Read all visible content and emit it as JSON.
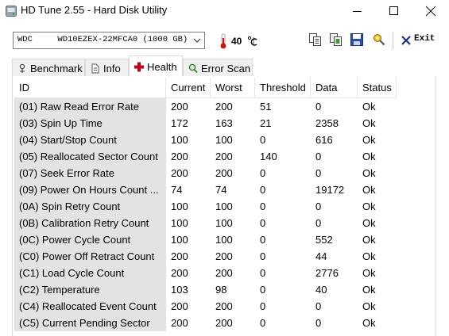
{
  "window": {
    "title": "HD Tune 2.55 - Hard Disk Utility"
  },
  "toolbar": {
    "drive": "WDC     WD10EZEX-22MFCA0 (1000 GB)",
    "temperature": "40",
    "exit_label": "Exit"
  },
  "tabs": [
    {
      "label": "Benchmark",
      "icon": "benchmark-icon"
    },
    {
      "label": "Info",
      "icon": "info-icon"
    },
    {
      "label": "Health",
      "icon": "health-cross-icon",
      "active": true
    },
    {
      "label": "Error Scan",
      "icon": "magnifier-icon"
    }
  ],
  "table": {
    "columns": [
      "ID",
      "Current",
      "Worst",
      "Threshold",
      "Data",
      "Status"
    ],
    "rows": [
      [
        "(01) Raw Read Error Rate",
        "200",
        "200",
        "51",
        "0",
        "Ok"
      ],
      [
        "(03) Spin Up Time",
        "172",
        "163",
        "21",
        "2358",
        "Ok"
      ],
      [
        "(04) Start/Stop Count",
        "100",
        "100",
        "0",
        "616",
        "Ok"
      ],
      [
        "(05) Reallocated Sector Count",
        "200",
        "200",
        "140",
        "0",
        "Ok"
      ],
      [
        "(07) Seek Error Rate",
        "200",
        "200",
        "0",
        "0",
        "Ok"
      ],
      [
        "(09) Power On Hours Count  ...",
        "74",
        "74",
        "0",
        "19172",
        "Ok"
      ],
      [
        "(0A) Spin Retry Count",
        "100",
        "100",
        "0",
        "0",
        "Ok"
      ],
      [
        "(0B) Calibration Retry Count",
        "100",
        "100",
        "0",
        "0",
        "Ok"
      ],
      [
        "(0C) Power Cycle Count",
        "100",
        "100",
        "0",
        "552",
        "Ok"
      ],
      [
        "(C0) Power Off Retract Count",
        "200",
        "200",
        "0",
        "44",
        "Ok"
      ],
      [
        "(C1) Load Cycle Count",
        "200",
        "200",
        "0",
        "2776",
        "Ok"
      ],
      [
        "(C2) Temperature",
        "103",
        "98",
        "0",
        "40",
        "Ok"
      ],
      [
        "(C4) Reallocated Event Count",
        "200",
        "200",
        "0",
        "0",
        "Ok"
      ],
      [
        "(C5) Current Pending Sector",
        "200",
        "200",
        "0",
        "0",
        "Ok"
      ]
    ]
  },
  "colors": {
    "id_column_bg": "#e3e3e3",
    "health_icon": "#c0001a",
    "thermometer": "#d01010"
  }
}
